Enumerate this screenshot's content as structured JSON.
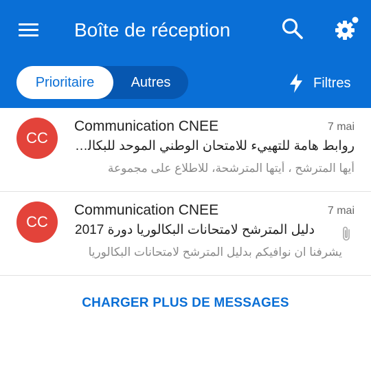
{
  "header": {
    "title": "Boîte de réception",
    "menu_icon": "menu-icon",
    "search_icon": "search-icon",
    "settings_icon": "gear-icon"
  },
  "tabs": {
    "active": "Prioritaire",
    "inactive": "Autres"
  },
  "filter": {
    "label": "Filtres",
    "icon": "bolt-icon"
  },
  "messages": [
    {
      "avatar": "CC",
      "sender": "Communication CNEE",
      "date": "7 mai",
      "subject": "روابط هامة للتهييء للامتحان الوطني الموحد للبكالوريا",
      "preview": "أيها المترشح ، أيتها المترشحة، للاطلاع على مجموعة",
      "has_attachment": false
    },
    {
      "avatar": "CC",
      "sender": "Communication CNEE",
      "date": "7 mai",
      "subject": "دليل المترشح لامتحانات البكالوريا دورة 2017",
      "preview": "يشرفنا ان نوافيكم بدليل المترشح لامتحانات البكالوريا",
      "has_attachment": true
    }
  ],
  "load_more": "CHARGER PLUS DE MESSAGES",
  "colors": {
    "brand": "#0a6fd6",
    "avatar": "#e3433a"
  }
}
